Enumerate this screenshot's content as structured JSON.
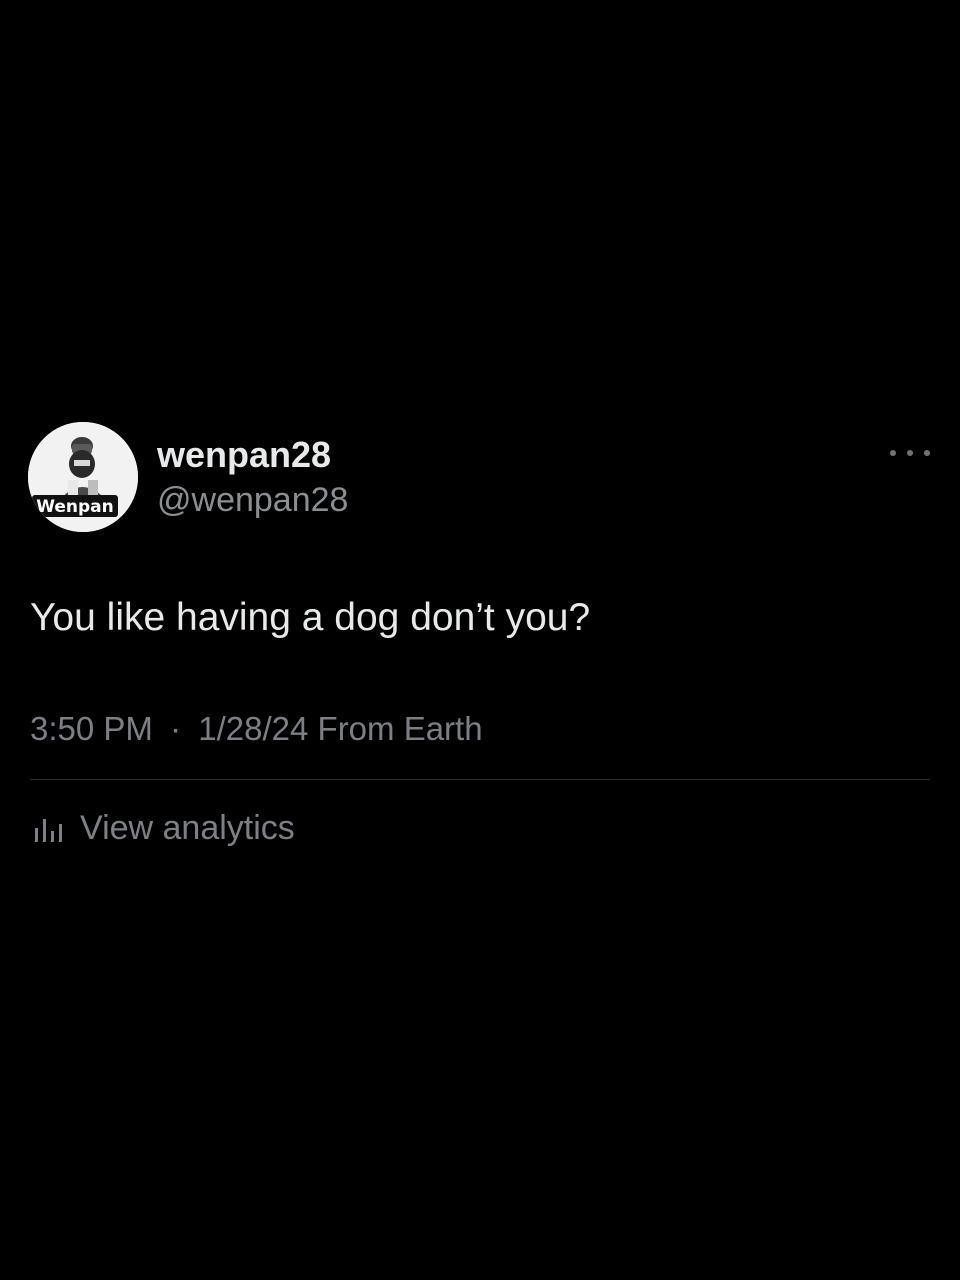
{
  "tweet": {
    "author": {
      "display_name": "wenpan28",
      "handle": "@wenpan28",
      "avatar_text": "Wenpan"
    },
    "text": "You like having a dog don’t you?",
    "time": "3:50 PM",
    "separator": "·",
    "date": "1/28/24",
    "source": "From Earth",
    "analytics_label": "View analytics"
  },
  "colors": {
    "background": "#000000",
    "primary_text": "#e7e9ea",
    "secondary_text": "#7c8086",
    "divider": "#2b2d30"
  },
  "icons": {
    "more": "more-dots-icon",
    "analytics": "bar-chart-icon"
  }
}
